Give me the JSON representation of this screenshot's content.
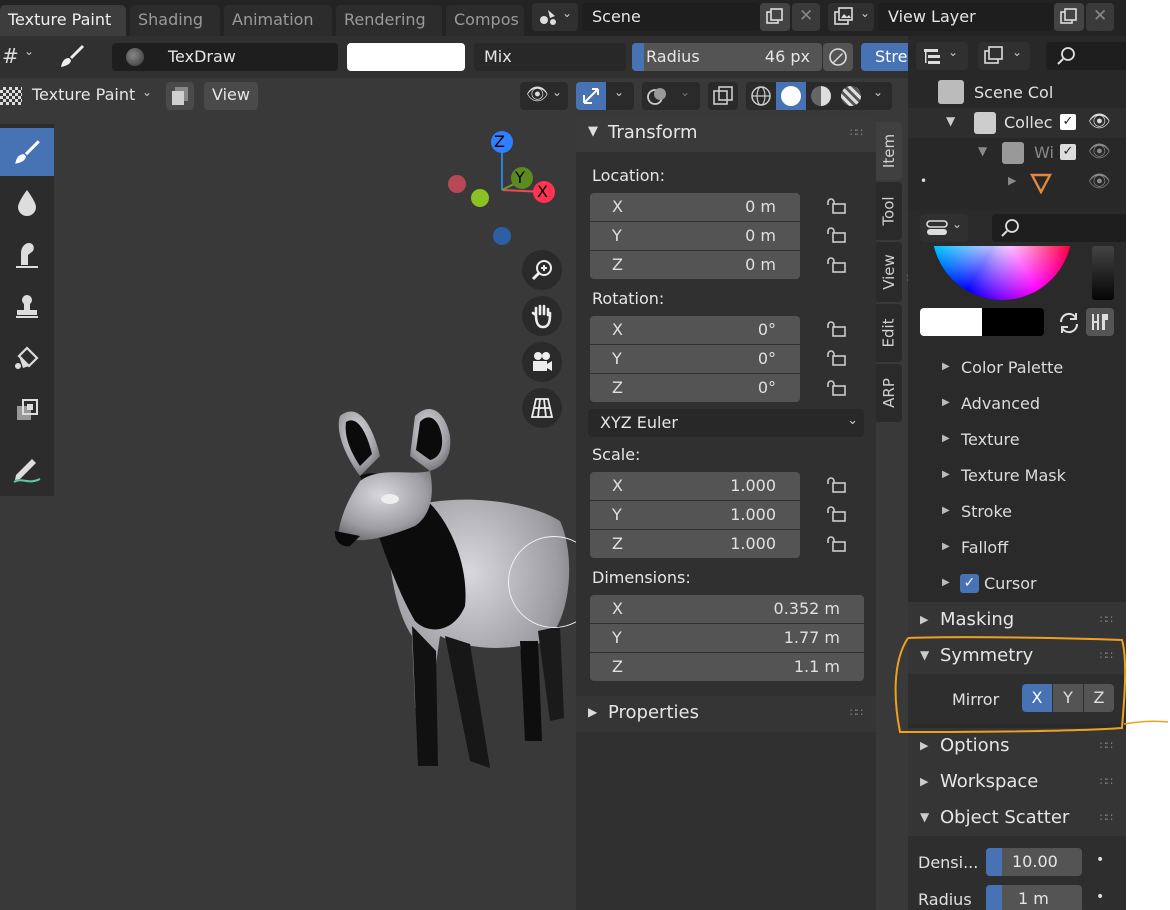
{
  "workspace_tabs": [
    "Texture Paint",
    "Shading",
    "Animation",
    "Rendering",
    "Compos"
  ],
  "scene": {
    "name": "Scene"
  },
  "view_layer": {
    "name": "View Layer"
  },
  "brush": {
    "name": "TexDraw",
    "blend": "Mix",
    "radius_label": "Radius",
    "radius_value": "46 px",
    "strength_label": "Stre",
    "color": "#ffffff"
  },
  "mode": {
    "label": "Texture Paint",
    "view_menu": "View"
  },
  "transform": {
    "title": "Transform",
    "location_label": "Location:",
    "location": [
      {
        "axis": "X",
        "value": "0 m"
      },
      {
        "axis": "Y",
        "value": "0 m"
      },
      {
        "axis": "Z",
        "value": "0 m"
      }
    ],
    "rotation_label": "Rotation:",
    "rotation": [
      {
        "axis": "X",
        "value": "0°"
      },
      {
        "axis": "Y",
        "value": "0°"
      },
      {
        "axis": "Z",
        "value": "0°"
      }
    ],
    "rotation_mode": "XYZ Euler",
    "scale_label": "Scale:",
    "scale": [
      {
        "axis": "X",
        "value": "1.000"
      },
      {
        "axis": "Y",
        "value": "1.000"
      },
      {
        "axis": "Z",
        "value": "1.000"
      }
    ],
    "dimensions_label": "Dimensions:",
    "dimensions": [
      {
        "axis": "X",
        "value": "0.352 m"
      },
      {
        "axis": "Y",
        "value": "1.77 m"
      },
      {
        "axis": "Z",
        "value": "1.1 m"
      }
    ]
  },
  "properties_section": "Properties",
  "sidebar_tabs": [
    "Item",
    "Tool",
    "View",
    "Edit",
    "ARP"
  ],
  "gizmo": {
    "z": "Z",
    "y": "Y",
    "x": "X"
  },
  "outliner": {
    "items": [
      {
        "label": "Scene Col"
      },
      {
        "label": "Collec"
      },
      {
        "label": "Wi"
      }
    ]
  },
  "brush_settings": {
    "subpanels": [
      "Color Palette",
      "Advanced",
      "Texture",
      "Texture Mask",
      "Stroke",
      "Falloff",
      "Cursor"
    ],
    "sections": {
      "masking": "Masking",
      "symmetry": "Symmetry",
      "mirror_label": "Mirror",
      "mirror_axes": [
        "X",
        "Y",
        "Z"
      ],
      "options": "Options",
      "workspace": "Workspace",
      "object_scatter": "Object Scatter",
      "density_label": "Densi...",
      "density_value": "10.00",
      "radius_label": "Radius",
      "radius_value": "1 m"
    }
  },
  "colors": {
    "accent": "#4772b3",
    "annotation": "#f0a020",
    "background": "#393939"
  }
}
